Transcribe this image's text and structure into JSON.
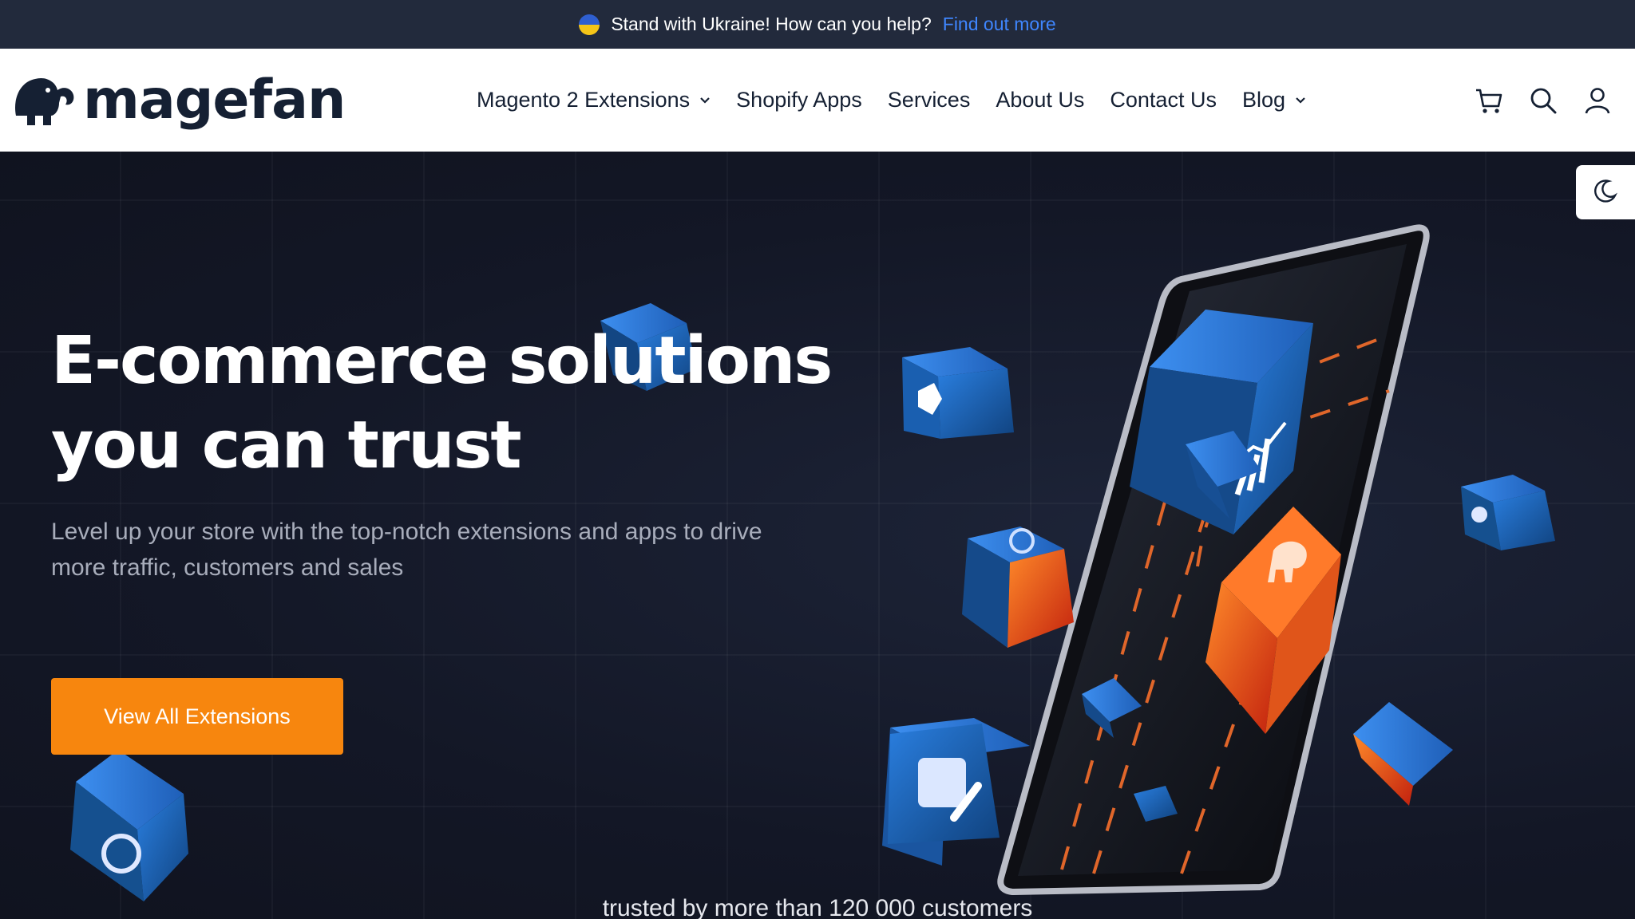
{
  "announcement": {
    "text": "Stand with Ukraine! How can you help?",
    "link": "Find out more",
    "link_color": "#3f86ff"
  },
  "brand": {
    "name": "magefan",
    "icon": "elephant-logo-icon",
    "color": "#152033"
  },
  "nav": {
    "items": [
      {
        "label": "Magento 2 Extensions",
        "has_dropdown": true
      },
      {
        "label": "Shopify Apps",
        "has_dropdown": false
      },
      {
        "label": "Services",
        "has_dropdown": false
      },
      {
        "label": "About Us",
        "has_dropdown": false
      },
      {
        "label": "Contact Us",
        "has_dropdown": false
      },
      {
        "label": "Blog",
        "has_dropdown": true
      }
    ]
  },
  "header_icons": [
    "cart-icon",
    "search-icon",
    "user-icon"
  ],
  "theme_toggle": {
    "icon": "moon-icon"
  },
  "hero": {
    "title_line1": "E-commerce solutions",
    "title_line2": "you can trust",
    "subtitle_line1": "Level up your store with the top-notch extensions and apps to drive",
    "subtitle_line2": "more traffic, customers and sales",
    "cta_label": "View All Extensions",
    "cta_color": "#f7860e",
    "trusted_text": "trusted by more than 120 000 customers"
  },
  "colors": {
    "topbar_bg": "#222a3c",
    "hero_bg": "#131726",
    "cube_blue": "#1e6fd0",
    "accent_orange": "#f7860e"
  }
}
